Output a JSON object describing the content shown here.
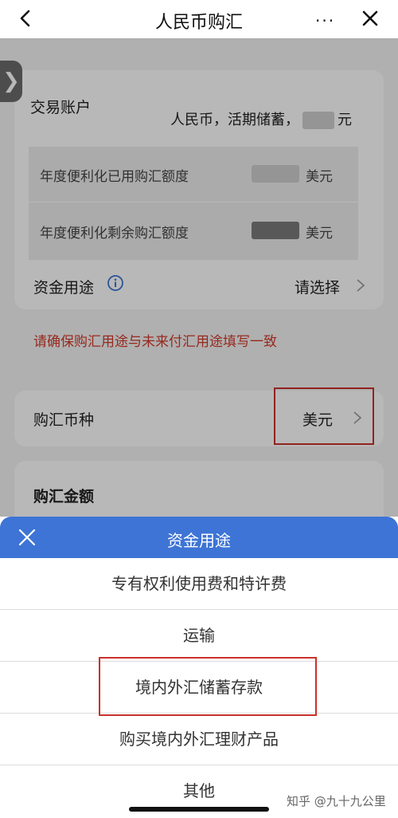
{
  "nav": {
    "title": "人民币购汇",
    "more": "···"
  },
  "side_tab": {
    "glyph": "❯"
  },
  "account": {
    "label": "交易账户",
    "value_prefix": "人民币，活期储蓄，",
    "value_suffix": "元"
  },
  "quota": {
    "used_label": "年度便利化已用购汇额度",
    "used_unit": "美元",
    "remaining_label": "年度便利化剩余购汇额度",
    "remaining_unit": "美元"
  },
  "purpose": {
    "label": "资金用途",
    "placeholder": "请选择"
  },
  "warning": "请确保购汇用途与未来付汇用途填写一致",
  "currency": {
    "label": "购汇币种",
    "value": "美元"
  },
  "amount": {
    "label": "购汇金额"
  },
  "sheet": {
    "title": "资金用途",
    "options": [
      "专有权利使用费和特许费",
      "运输",
      "境内外汇储蓄存款",
      "购买境内外汇理财产品",
      "其他"
    ]
  },
  "watermark": "知乎 @九十九公里",
  "colors": {
    "accent": "#3d74d6",
    "warning": "#d23a2a",
    "highlight_box": "#c9312a"
  }
}
